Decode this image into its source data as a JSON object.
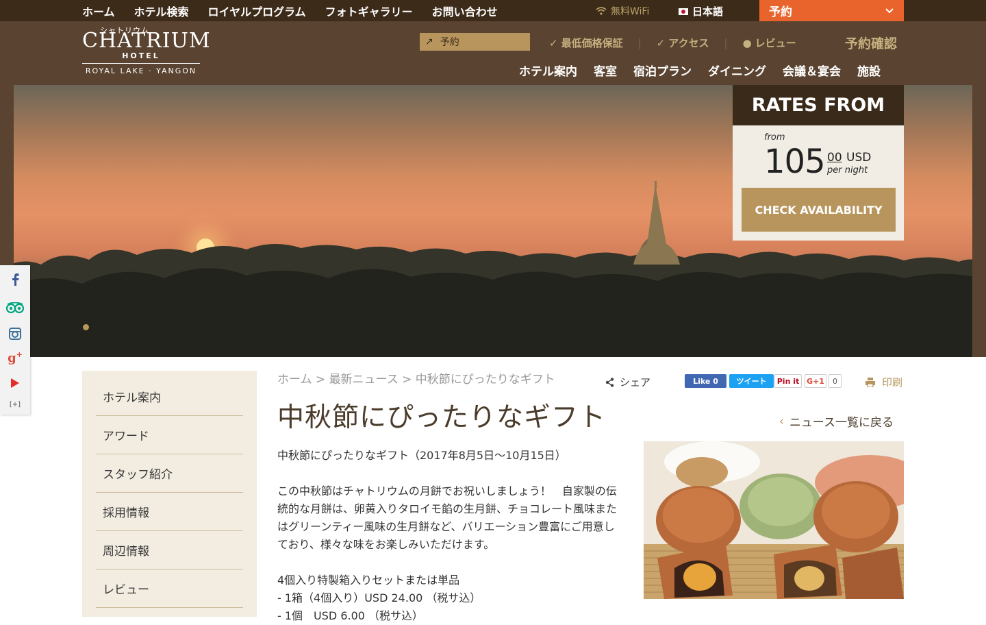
{
  "topbar": {
    "nav": [
      "ホーム",
      "ホテル検索",
      "ロイヤルプログラム",
      "フォトギャラリー",
      "お問い合わせ"
    ],
    "wifi_label": "無料WiFi",
    "language": "日本語",
    "book_label": "予約"
  },
  "header": {
    "logo": {
      "kana": "シャトリウム",
      "name": "CHATRIUM",
      "hotel": "HOTEL",
      "location": "ROYAL LAKE · YANGON"
    },
    "reserve_label": "予約",
    "checks": [
      "最低価格保証",
      "アクセス",
      "レビュー"
    ],
    "confirm_label": "予約確認",
    "nav": [
      "ホテル案内",
      "客室",
      "宿泊プラン",
      "ダイニング",
      "会議＆宴会",
      "施設"
    ]
  },
  "rates": {
    "heading": "RATES FROM",
    "from": "from",
    "price": "105",
    "cents": "00",
    "currency": "USD",
    "per": "per night",
    "cta": "CHECK AVAILABILITY"
  },
  "social": {
    "more": "[+]"
  },
  "sidebar": {
    "items": [
      "ホテル案内",
      "アワード",
      "スタッフ紹介",
      "採用情報",
      "周辺情報",
      "レビュー"
    ]
  },
  "breadcrumb": {
    "home": "ホーム",
    "sep": ">",
    "news": "最新ニュース",
    "current": "中秋節にぴったりなギフト"
  },
  "share": {
    "label": "シェア",
    "fb": "Like 0",
    "tweet": "ツイート",
    "pin": "Pin it",
    "gplus": "G+1",
    "gcount": "0"
  },
  "print_label": "印刷",
  "article": {
    "title": "中秋節にぴったりなギフト",
    "back": "ニュース一覧に戻る",
    "intro": "中秋節にぴったりなギフト（2017年8月5日〜10月15日）",
    "para": "この中秋節はチャトリウムの月餅でお祝いしましょう！　自家製の伝統的な月餅は、卵黄入りタロイモ餡の生月餅、チョコレート風味またはグリーンティー風味の生月餅など、バリエーション豊富にご用意しており、様々な味をお楽しみいただけます。",
    "list_title": "4個入り特製箱入りセットまたは単品",
    "line1": "- 1箱（4個入り）USD 24.00 （税サ込）",
    "line2": "- 1個　USD 6.00 （税サ込）"
  }
}
